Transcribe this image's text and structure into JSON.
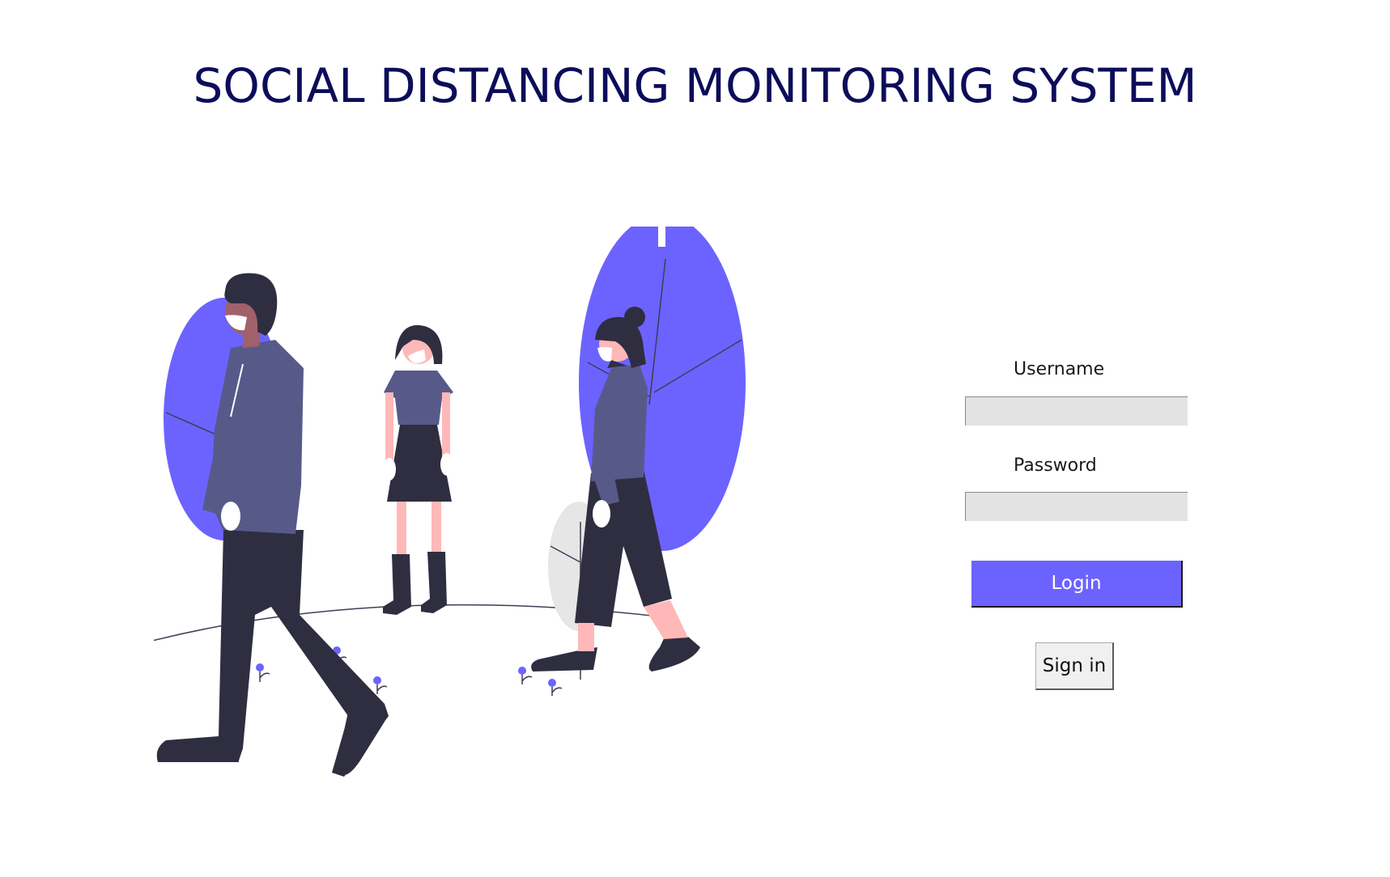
{
  "header": {
    "title": "SOCIAL DISTANCING MONITORING SYSTEM"
  },
  "illustration": {
    "description_icon": "people-walking-with-masks-illustration"
  },
  "login_form": {
    "username_label": "Username",
    "username_value": "",
    "password_label": "Password",
    "password_value": "",
    "login_label": "Login",
    "signin_label": "Sign in"
  },
  "colors": {
    "title": "#0c0d5a",
    "accent": "#6c63ff",
    "field_bg": "#e3e3e3",
    "dark": "#2f2e41",
    "jacket": "#575a89",
    "skin": "#ffb8b8",
    "light_leaf": "#e6e6e6"
  }
}
